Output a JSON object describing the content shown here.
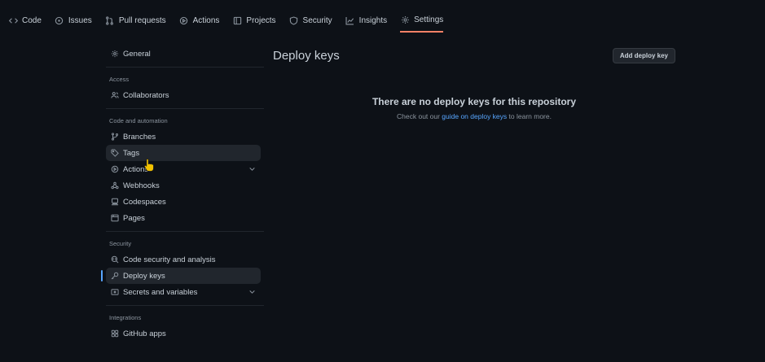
{
  "topnav": {
    "tabs": [
      {
        "label": "Code",
        "icon": "code-icon"
      },
      {
        "label": "Issues",
        "icon": "issue-opened-icon"
      },
      {
        "label": "Pull requests",
        "icon": "git-pull-request-icon"
      },
      {
        "label": "Actions",
        "icon": "play-icon"
      },
      {
        "label": "Projects",
        "icon": "table-icon"
      },
      {
        "label": "Security",
        "icon": "shield-icon"
      },
      {
        "label": "Insights",
        "icon": "graph-icon"
      },
      {
        "label": "Settings",
        "icon": "gear-icon",
        "selected": true
      }
    ]
  },
  "sidebar": {
    "general": "General",
    "access_heading": "Access",
    "collaborators": "Collaborators",
    "code_heading": "Code and automation",
    "branches": "Branches",
    "tags": "Tags",
    "actions": "Actions",
    "webhooks": "Webhooks",
    "codespaces": "Codespaces",
    "pages": "Pages",
    "security_heading": "Security",
    "code_security": "Code security and analysis",
    "deploy_keys": "Deploy keys",
    "secrets": "Secrets and variables",
    "integrations_heading": "Integrations",
    "github_apps": "GitHub apps"
  },
  "main": {
    "title": "Deploy keys",
    "add_button": "Add deploy key",
    "blank_title": "There are no deploy keys for this repository",
    "blank_desc_prefix": "Check out our ",
    "blank_desc_link": "guide on deploy keys",
    "blank_desc_suffix": " to learn more."
  },
  "colors": {
    "background": "#0d1117",
    "accent_link": "#58a6ff",
    "selected_tab_underline": "#f78166"
  }
}
